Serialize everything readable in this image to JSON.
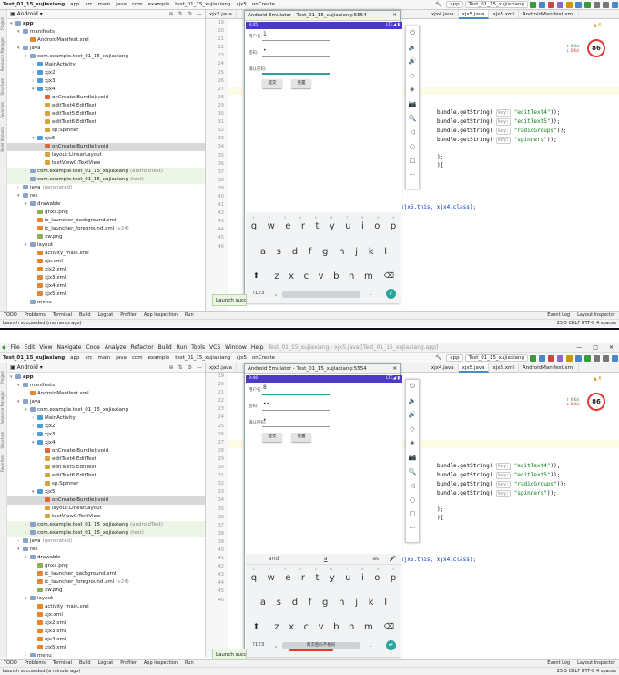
{
  "project": "Test_01_15_xujiaxiang",
  "breadcrumbs": [
    "app",
    "src",
    "main",
    "java",
    "com",
    "example",
    "test_01_15_xujiaxiang",
    "xjx5",
    "onCreate"
  ],
  "run_config": "app",
  "device": "Test_01_15_xujiaxiang",
  "menu": [
    "File",
    "Edit",
    "View",
    "Navigate",
    "Code",
    "Analyze",
    "Refactor",
    "Build",
    "Run",
    "Tools",
    "VCS",
    "Window",
    "Help"
  ],
  "menu_title": "Test_01_15_xujiaxiang - xjx5.java [Test_01_15_xujiaxiang.app]",
  "panel_title": "Android",
  "tree": [
    {
      "d": 0,
      "arr": "▾",
      "ic": "folder",
      "label": "app",
      "bold": true
    },
    {
      "d": 1,
      "arr": "▾",
      "ic": "folder",
      "label": "manifests"
    },
    {
      "d": 2,
      "arr": "",
      "ic": "xml",
      "label": "AndroidManifest.xml"
    },
    {
      "d": 1,
      "arr": "▾",
      "ic": "folder",
      "label": "java"
    },
    {
      "d": 2,
      "arr": "▾",
      "ic": "folder",
      "label": "com.example.test_01_15_xujiaxiang"
    },
    {
      "d": 3,
      "arr": "›",
      "ic": "class",
      "label": "MainActivity"
    },
    {
      "d": 3,
      "arr": "›",
      "ic": "class",
      "label": "xjx2"
    },
    {
      "d": 3,
      "arr": "›",
      "ic": "class",
      "label": "xjx3"
    },
    {
      "d": 3,
      "arr": "▾",
      "ic": "class",
      "label": "xjx4"
    },
    {
      "d": 4,
      "arr": "",
      "ic": "method",
      "label": "onCreate(Bundle):void"
    },
    {
      "d": 4,
      "arr": "",
      "ic": "field",
      "label": "editText4:EditText"
    },
    {
      "d": 4,
      "arr": "",
      "ic": "field",
      "label": "editText5:EditText"
    },
    {
      "d": 4,
      "arr": "",
      "ic": "field",
      "label": "editText6:EditText"
    },
    {
      "d": 4,
      "arr": "",
      "ic": "field",
      "label": "sp:Spinner"
    },
    {
      "d": 3,
      "arr": "▾",
      "ic": "class",
      "label": "xjx5"
    },
    {
      "d": 4,
      "arr": "",
      "ic": "method",
      "label": "onCreate(Bundle):void",
      "sel": true
    },
    {
      "d": 4,
      "arr": "",
      "ic": "field",
      "label": "layout:LinearLayout"
    },
    {
      "d": 4,
      "arr": "",
      "ic": "field",
      "label": "textView0:TextView"
    },
    {
      "d": 2,
      "arr": "›",
      "ic": "folder",
      "label": "com.example.test_01_15_xujiaxiang",
      "suffix": "(androidTest)",
      "hl": true
    },
    {
      "d": 2,
      "arr": "›",
      "ic": "folder",
      "label": "com.example.test_01_15_xujiaxiang",
      "suffix": "(test)",
      "hl": true
    },
    {
      "d": 1,
      "arr": "›",
      "ic": "folder",
      "label": "java",
      "suffix": "(generated)"
    },
    {
      "d": 1,
      "arr": "▾",
      "ic": "folder",
      "label": "res"
    },
    {
      "d": 2,
      "arr": "▾",
      "ic": "folder",
      "label": "drawable"
    },
    {
      "d": 3,
      "arr": "",
      "ic": "img",
      "label": "gnxx.png"
    },
    {
      "d": 3,
      "arr": "",
      "ic": "xml",
      "label": "ic_launcher_background.xml"
    },
    {
      "d": 3,
      "arr": "",
      "ic": "xml",
      "label": "ic_launcher_foreground.xml",
      "suffix": "(v24)"
    },
    {
      "d": 3,
      "arr": "",
      "ic": "img",
      "label": "xw.png"
    },
    {
      "d": 2,
      "arr": "▾",
      "ic": "folder",
      "label": "layout"
    },
    {
      "d": 3,
      "arr": "",
      "ic": "xml",
      "label": "activity_main.xml"
    },
    {
      "d": 3,
      "arr": "",
      "ic": "xml",
      "label": "xjx.xml"
    },
    {
      "d": 3,
      "arr": "",
      "ic": "xml",
      "label": "xjx2.xml"
    },
    {
      "d": 3,
      "arr": "",
      "ic": "xml",
      "label": "xjx3.xml"
    },
    {
      "d": 3,
      "arr": "",
      "ic": "xml",
      "label": "xjx4.xml"
    },
    {
      "d": 3,
      "arr": "",
      "ic": "xml",
      "label": "xjx5.xml"
    },
    {
      "d": 2,
      "arr": "›",
      "ic": "folder",
      "label": "menu"
    }
  ],
  "editor_tabs": [
    "xjx2.java",
    "xjx4.java",
    "xjx5.java",
    "xjx5.xml",
    "AndroidManifest.xml"
  ],
  "gutter": [
    "19",
    "20",
    "21",
    "22",
    "23",
    "24",
    "25",
    "26",
    "27",
    "28",
    "29",
    "30",
    "31",
    "32",
    "33",
    "34",
    "35",
    "36",
    "37",
    "38",
    "39",
    "40",
    "41",
    "42",
    "43",
    "44",
    "45",
    "46"
  ],
  "code": [
    {
      "key": "editText4",
      "str": "\"editText4\""
    },
    {
      "key": "editText5",
      "str": "\"editText5\""
    },
    {
      "key": "radioGroups",
      "str": "\"radioGroups\""
    },
    {
      "key": "spinners",
      "str": "\"spinners\""
    }
  ],
  "code_prefix": "bundle.getString(",
  "code_key_hint": "key:",
  "code_close": "));",
  "code_brace1": ");",
  "code_brace2": "){",
  "code_intent": "xjx5.this, xjx4.class);",
  "warn_count": "▲ 6",
  "score": "86",
  "speed_up": "0 K/s",
  "speed_dn": "0 K/s",
  "emulator_title": "Android Emulator - Test_01_15_xujiaxiang:5554",
  "form": {
    "user_label": "用户名:",
    "pwd_label": "密码:",
    "confirm_label": "确认密码:",
    "submit": "提交",
    "reset": "重置"
  },
  "frame1": {
    "time": "9:45",
    "status_right": "LTE◢ ▮",
    "user_value": "1",
    "pwd_value": "•",
    "confirm_value": ""
  },
  "frame2": {
    "time": "9:46",
    "status_right": "LTE◢ ▮",
    "user_value": "8",
    "pwd_value": "••",
    "confirm_value": "•",
    "suggestions": [
      "and",
      "a",
      "as"
    ],
    "toast": "两次密码不相同"
  },
  "kb_row1": [
    "q",
    "w",
    "e",
    "r",
    "t",
    "y",
    "u",
    "i",
    "o",
    "p"
  ],
  "kb_nums": [
    "1",
    "2",
    "3",
    "4",
    "5",
    "6",
    "7",
    "8",
    "9",
    "0"
  ],
  "kb_row2": [
    "a",
    "s",
    "d",
    "f",
    "g",
    "h",
    "j",
    "k",
    "l"
  ],
  "kb_row3": [
    "z",
    "x",
    "c",
    "v",
    "b",
    "n",
    "m"
  ],
  "kb_123": "?123",
  "launch_toast": "Launch succ",
  "bottom_tools": [
    "TODO",
    "Problems",
    "Terminal",
    "Build",
    "Logcat",
    "Profiler",
    "App Inspection",
    "Run"
  ],
  "bottom_right": [
    "Event Log",
    "Layout Inspector"
  ],
  "status_text": "Launch succeeded (moments ago)",
  "status_text2": "Launch succeeded (a minute ago)",
  "status_right": "25:5  CRLF  UTF-8  4 spaces",
  "emu_side_icons": [
    "⏻",
    "🔈",
    "🔊",
    "◇",
    "◈",
    "📷",
    "🔍",
    "◁",
    "○",
    "□",
    "···"
  ]
}
